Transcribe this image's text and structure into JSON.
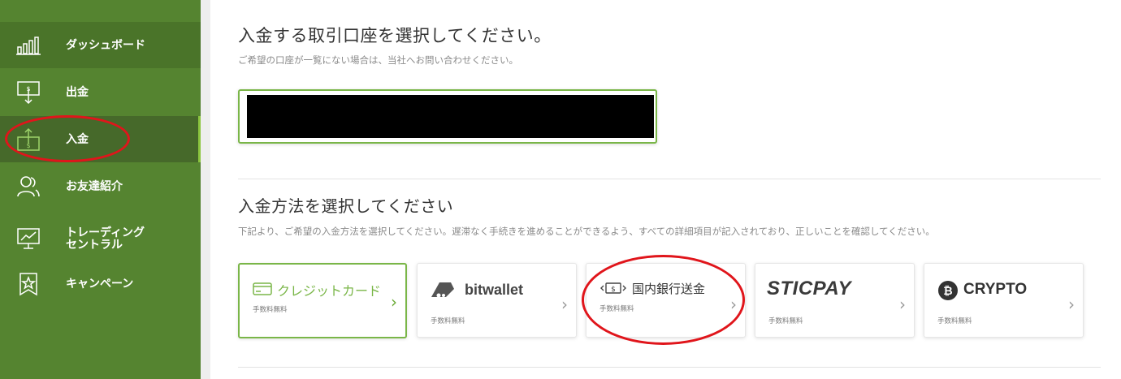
{
  "sidebar": {
    "items": [
      {
        "label": "ダッシュボード",
        "icon": "bar-chart-icon"
      },
      {
        "label": "出金",
        "icon": "withdraw-icon"
      },
      {
        "label": "入金",
        "icon": "deposit-icon",
        "active": true
      },
      {
        "label": "お友達紹介",
        "icon": "friends-icon"
      },
      {
        "label": "トレーディング\nセントラル",
        "icon": "monitor-chart-icon"
      },
      {
        "label": "キャンペーン",
        "icon": "ribbon-star-icon"
      }
    ]
  },
  "main": {
    "account_title": "入金する取引口座を選択してください。",
    "account_note": "ご希望の口座が一覧にない場合は、当社へお問い合わせください。",
    "method_title": "入金方法を選択してください",
    "method_note": "下記より、ご希望の入金方法を選択してください。遅滞なく手続きを進めることができるよう、すべての詳細項目が記入されており、正しいことを確認してください。"
  },
  "methods": [
    {
      "name": "クレジットカード",
      "fee": "手数料無料",
      "icon": "credit-card-icon",
      "selected": true
    },
    {
      "name": "bitwallet",
      "fee": "手数料無料",
      "icon": "bitwallet-logo-icon"
    },
    {
      "name": "国内銀行送金",
      "fee": "手数料無料",
      "icon": "bank-transfer-icon"
    },
    {
      "name": "STICPAY",
      "fee": "手数料無料",
      "icon": "sticpay-logo-icon"
    },
    {
      "name": "CRYPTO",
      "fee": "手数料無料",
      "icon": "bitcoin-icon"
    }
  ],
  "colors": {
    "sidebar": "#558430",
    "sidebar_active": "#46692a",
    "accent": "#7ab648",
    "annotation": "#e0151b"
  }
}
